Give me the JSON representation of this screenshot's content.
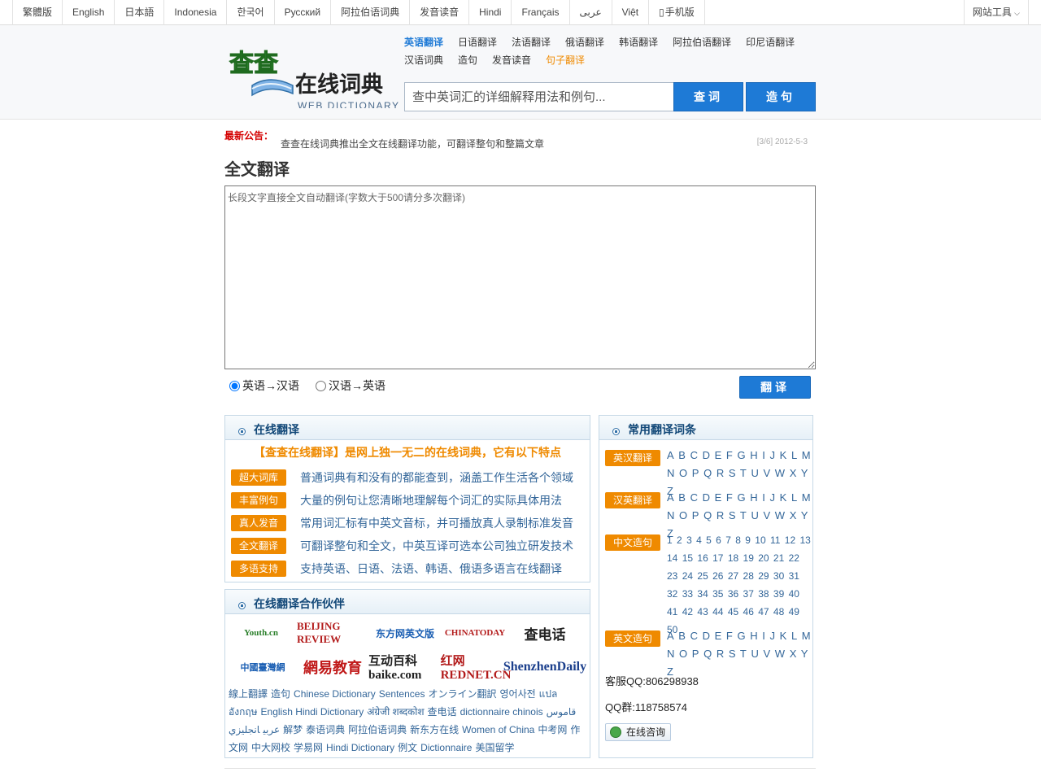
{
  "top_nav": {
    "languages": [
      "繁體版",
      "English",
      "日本語",
      "Indonesia",
      "한국어",
      "Русский",
      "阿拉伯语词典",
      "发音读音",
      "Hindi",
      "Français",
      "عربى",
      "Việt",
      "手机版"
    ],
    "site_tools": "网站工具"
  },
  "logo": {
    "cn": "在线词典",
    "en": "WEB DICTIONARY",
    "mark": "查查"
  },
  "nav": {
    "row1": [
      "英语翻译",
      "日语翻译",
      "法语翻译",
      "俄语翻译",
      "韩语翻译",
      "阿拉伯语翻译",
      "印尼语翻译"
    ],
    "row2": [
      "汉语词典",
      "造句",
      "发音读音",
      "句子翻译"
    ]
  },
  "search": {
    "placeholder": "查中英词汇的详细解释用法和例句...",
    "query_label": "查词",
    "sentence_label": "造句"
  },
  "notice": {
    "label": "最新公告：",
    "text": "查查在线词典推出全文在线翻译功能，可翻译整句和整篇文章",
    "date": "[3/6] 2012-5-3"
  },
  "page_title": "全文翻译",
  "translator": {
    "placeholder": "长段文字直接全文自动翻译(字数大于500请分多次翻译)",
    "option_en_zh": "英语→汉语",
    "option_zh_en": "汉语→英语",
    "translate_label": "翻译"
  },
  "features": {
    "title": "在线翻译",
    "intro": "【查查在线翻译】是网上独一无二的在线词典，它有以下特点",
    "items": [
      {
        "badge": "超大词库",
        "text": "普通词典有和没有的都能查到，涵盖工作生活各个领域"
      },
      {
        "badge": "丰富例句",
        "text": "大量的例句让您清晰地理解每个词汇的实际具体用法"
      },
      {
        "badge": "真人发音",
        "text": "常用词汇标有中英文音标，并可播放真人录制标准发音"
      },
      {
        "badge": "全文翻译",
        "text": "可翻译整句和全文，中英互译可选本公司独立研发技术"
      },
      {
        "badge": "多语支持",
        "text": "支持英语、日语、法语、韩语、俄语多语言在线翻译"
      }
    ]
  },
  "partners": {
    "title": "在线翻译合作伙伴",
    "logos": [
      "Youth.cn",
      "BEIJING REVIEW",
      "东方网英文版",
      "CHINATODAY",
      "查电话",
      "中國臺灣網",
      "網易教育",
      "互动百科 baike.com",
      "红网 REDNET.CN",
      "ShenzhenDaily"
    ],
    "links": [
      "線上翻譯",
      "造句",
      "Chinese Dictionary",
      "Sentences",
      "オンライン翻訳",
      "영어사전",
      "แปลอังกฤษ",
      "English Hindi Dictionary",
      "अंग्रेजी शब्दकोश",
      "查电话",
      "dictionnaire chinois",
      "قاموس عربي",
      "انجليزي",
      "解梦",
      "泰语词典",
      "阿拉伯语词典",
      "新东方在线",
      "Women of China",
      "中考网",
      "作文网",
      "中大网校",
      "学易网",
      "Hindi Dictionary",
      "例文",
      "Dictionnaire",
      "美国留学"
    ]
  },
  "terms": {
    "title": "常用翻译词条",
    "en_zh_badge": "英汉翻译",
    "zh_en_badge": "汉英翻译",
    "cn_sentence_badge": "中文造句",
    "en_sentence_badge": "英文造句",
    "letters": [
      "A",
      "B",
      "C",
      "D",
      "E",
      "F",
      "G",
      "H",
      "I",
      "J",
      "K",
      "L",
      "M",
      "N",
      "O",
      "P",
      "Q",
      "R",
      "S",
      "T",
      "U",
      "V",
      "W",
      "X",
      "Y",
      "Z"
    ],
    "numbers": [
      "1",
      "2",
      "3",
      "4",
      "5",
      "6",
      "7",
      "8",
      "9",
      "10",
      "11",
      "12",
      "13",
      "14",
      "15",
      "16",
      "17",
      "18",
      "19",
      "20",
      "21",
      "22",
      "23",
      "24",
      "25",
      "26",
      "27",
      "28",
      "29",
      "30",
      "31",
      "32",
      "33",
      "34",
      "35",
      "36",
      "37",
      "38",
      "39",
      "40",
      "41",
      "42",
      "43",
      "44",
      "45",
      "46",
      "47",
      "48",
      "49",
      "50"
    ],
    "qq_service": "客服QQ:806298938",
    "qq_group": "QQ群:118758574",
    "consult_label": "在线咨询"
  }
}
